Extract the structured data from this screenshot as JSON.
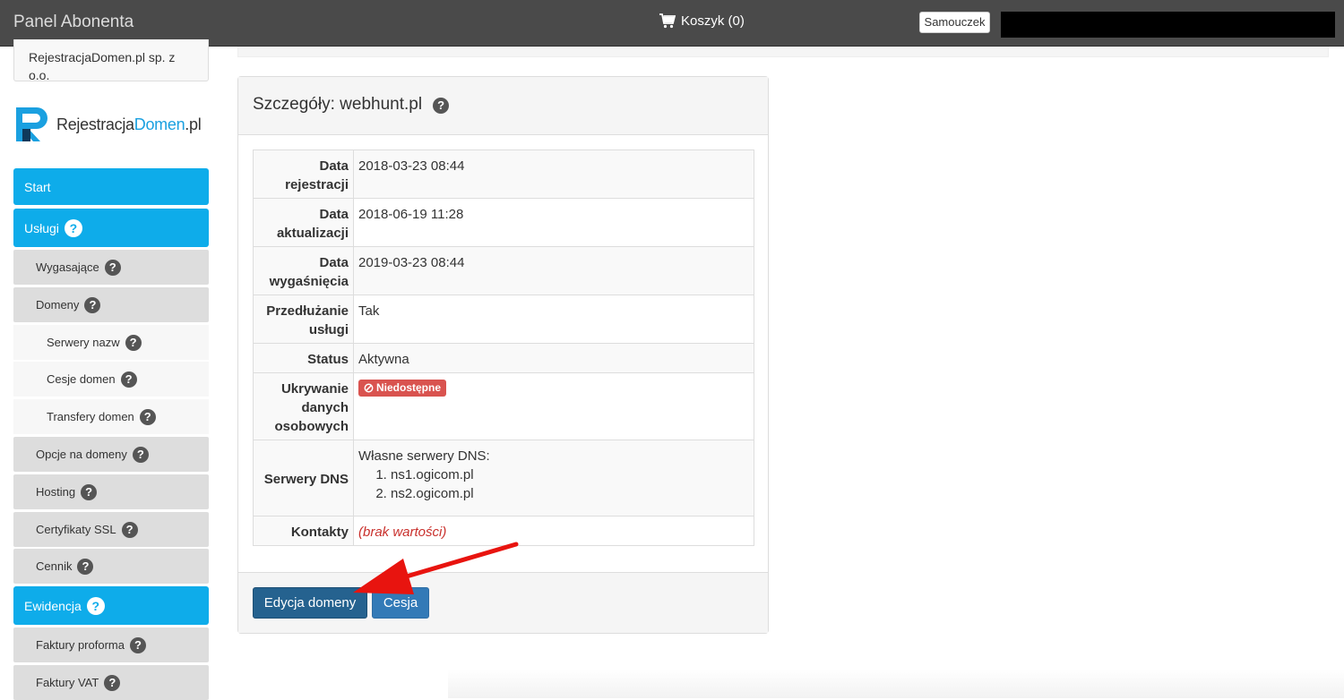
{
  "topbar": {
    "title": "Panel Abonenta",
    "cart_label": "Koszyk (0)",
    "tutorial_label": "Samouczek"
  },
  "sidebar": {
    "company_line1": "RejestracjaDomen.pl sp. z",
    "company_line2": "o.o.",
    "logo_text_a": "Rejestracja",
    "logo_text_b": "Domen",
    "logo_text_c": ".pl",
    "items": [
      {
        "label": "Start"
      },
      {
        "label": "Usługi"
      },
      {
        "label": "Wygasające"
      },
      {
        "label": "Domeny"
      },
      {
        "label": "Serwery nazw"
      },
      {
        "label": "Cesje domen"
      },
      {
        "label": "Transfery domen"
      },
      {
        "label": "Opcje na domeny"
      },
      {
        "label": "Hosting"
      },
      {
        "label": "Certyfikaty SSL"
      },
      {
        "label": "Cennik"
      },
      {
        "label": "Ewidencja"
      },
      {
        "label": "Faktury proforma"
      },
      {
        "label": "Faktury VAT"
      }
    ]
  },
  "panel": {
    "title": "Szczegóły: webhunt.pl",
    "rows": {
      "reg_label": "Data rejestracji",
      "reg_value": "2018-03-23 08:44",
      "upd_label": "Data aktualizacji",
      "upd_value": "2018-06-19 11:28",
      "exp_label": "Data wygaśnięcia",
      "exp_value": "2019-03-23 08:44",
      "renew_label": "Przedłużanie usługi",
      "renew_value": "Tak",
      "status_label": "Status",
      "status_value": "Aktywna",
      "privacy_label": "Ukrywanie danych osobowych",
      "privacy_value": "Niedostępne",
      "dns_label": "Serwery DNS",
      "dns_intro": "Własne serwery DNS:",
      "dns1": "ns1.ogicom.pl",
      "dns2": "ns2.ogicom.pl",
      "contacts_label": "Kontakty",
      "contacts_value": "(brak wartości)"
    },
    "edit_button": "Edycja domeny",
    "transfer_button": "Cesja"
  },
  "colors": {
    "primary_nav": "#0eacea",
    "badge_danger": "#d9534f",
    "button_primary": "#337ab7",
    "annotation_arrow": "#e8140f"
  }
}
